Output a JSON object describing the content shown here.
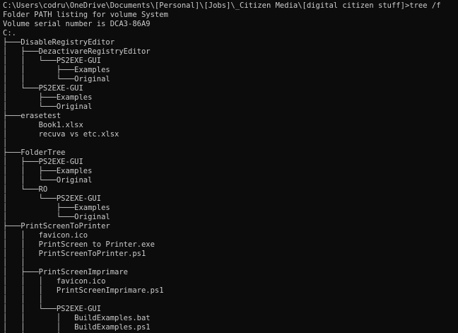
{
  "terminal": {
    "background_color": "#0c0c0c",
    "text_color": "#cccccc",
    "lines": [
      "C:\\Users\\codru\\OneDrive\\Documents\\[Personal]\\[Jobs]\\_Citizen Media\\[digital citizen stuff]>tree /f",
      "Folder PATH listing for volume System",
      "Volume serial number is DCA3-86A9",
      "C:.",
      "├───DisableRegistryEditor",
      "│   ├───DezactivareRegistryEditor",
      "│   │   └───PS2EXE-GUI",
      "│   │       ├───Examples",
      "│   │       └───Original",
      "│   └───PS2EXE-GUI",
      "│       ├───Examples",
      "│       └───Original",
      "├───erasetest",
      "│       Book1.xlsx",
      "│       recuva vs etc.xlsx",
      "│",
      "├───FolderTree",
      "│   ├───PS2EXE-GUI",
      "│   │   ├───Examples",
      "│   │   └───Original",
      "│   └───RO",
      "│       └───PS2EXE-GUI",
      "│           ├───Examples",
      "│           └───Original",
      "├───PrintScreenToPrinter",
      "│   │   favicon.ico",
      "│   │   PrintScreen to Printer.exe",
      "│   │   PrintScreenToPrinter.ps1",
      "│   │",
      "│   ├───PrintScreenImprimare",
      "│   │   │   favicon.ico",
      "│   │   │   PrintScreenImprimare.ps1",
      "│   │   │",
      "│   │   └───PS2EXE-GUI",
      "│   │       │   BuildExamples.bat",
      "│   │       │   BuildExamples.ps1",
      "│   │       │"
    ]
  }
}
